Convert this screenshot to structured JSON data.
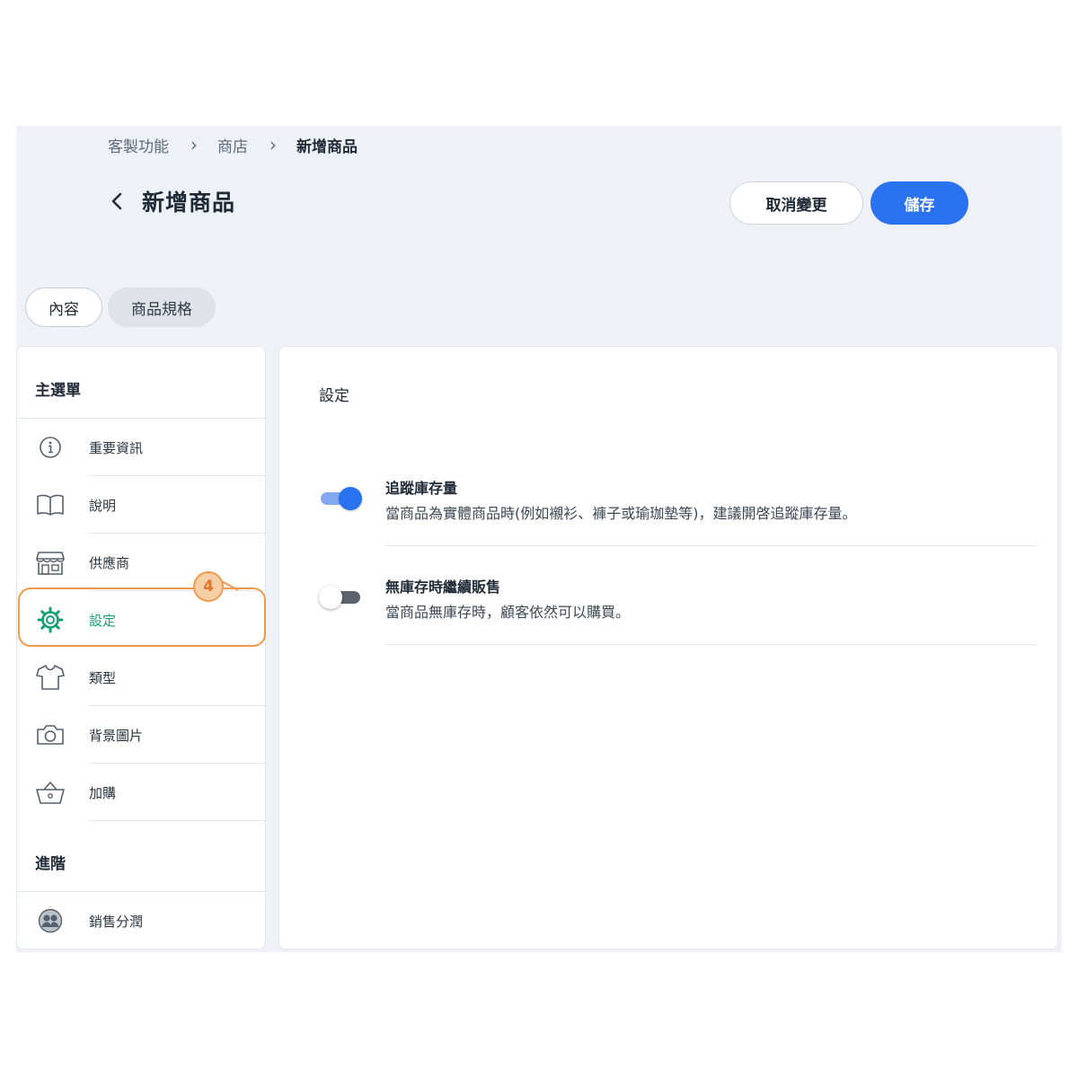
{
  "breadcrumb": {
    "item1": "客製功能",
    "item2": "商店",
    "current": "新增商品"
  },
  "header": {
    "title": "新增商品",
    "cancel_label": "取消變更",
    "save_label": "儲存"
  },
  "tabs": {
    "content": "內容",
    "spec": "商品規格"
  },
  "sidebar": {
    "main_heading": "主選單",
    "items": [
      {
        "label": "重要資訊",
        "icon": "info-icon"
      },
      {
        "label": "說明",
        "icon": "book-icon"
      },
      {
        "label": "供應商",
        "icon": "store-icon"
      },
      {
        "label": "設定",
        "icon": "gear-icon",
        "active": true
      },
      {
        "label": "類型",
        "icon": "tshirt-icon"
      },
      {
        "label": "背景圖片",
        "icon": "camera-icon"
      },
      {
        "label": "加購",
        "icon": "basket-icon"
      }
    ],
    "advanced_heading": "進階",
    "advanced_items": [
      {
        "label": "銷售分潤",
        "icon": "people-icon"
      }
    ]
  },
  "step_badge": "4",
  "main": {
    "title": "設定",
    "settings": [
      {
        "title": "追蹤庫存量",
        "description": "當商品為實體商品時(例如襯衫、褲子或瑜珈墊等)，建議開啓追蹤庫存量。",
        "enabled": true
      },
      {
        "title": "無庫存時繼續販售",
        "description": "當商品無庫存時，顧客依然可以購買。",
        "enabled": false
      }
    ]
  },
  "colors": {
    "accent": "#2a72f0",
    "active_nav": "#169f73",
    "highlight": "#f19a4c",
    "background": "#eef1f5"
  }
}
